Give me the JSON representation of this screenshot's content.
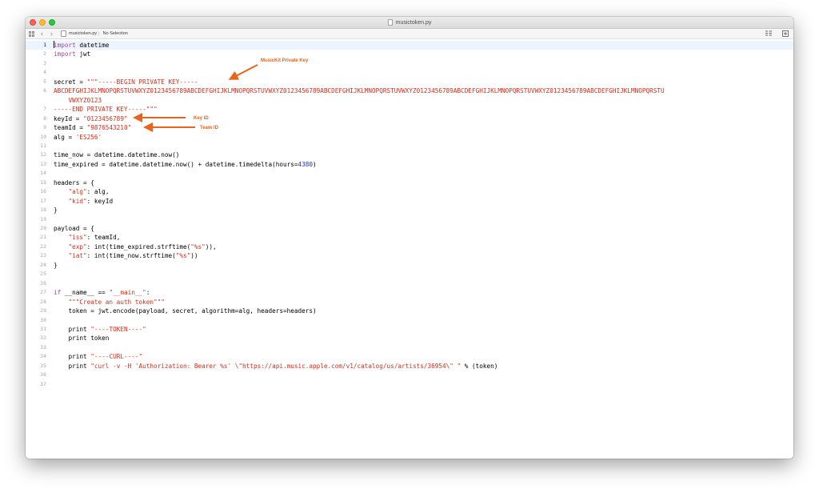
{
  "window": {
    "title": "musictoken.py"
  },
  "jumpbar": {
    "filename": "musictoken.py",
    "separator": "〉",
    "selection": "No Selection"
  },
  "annotations": {
    "private_key": "MusicKit Private Key",
    "key_id": "Key ID",
    "team_id": "Team ID",
    "color": "#e8641b"
  },
  "colors": {
    "keyword": "#ad3da4",
    "string": "#d12f1b",
    "number": "#272ad8",
    "current_line": "#ecf5ff"
  },
  "code": {
    "line_numbers": [
      "1",
      "2",
      "3",
      "4",
      "5",
      "6",
      "",
      "7",
      "8",
      "9",
      "10",
      "11",
      "12",
      "13",
      "14",
      "15",
      "16",
      "17",
      "18",
      "19",
      "20",
      "21",
      "22",
      "23",
      "24",
      "25",
      "26",
      "27",
      "28",
      "29",
      "30",
      "31",
      "32",
      "33",
      "34",
      "35",
      "36",
      "37"
    ],
    "lines": [
      [
        {
          "t": "kw",
          "v": "import"
        },
        {
          "t": "",
          "v": " datetime"
        }
      ],
      [
        {
          "t": "kw",
          "v": "import"
        },
        {
          "t": "",
          "v": " jwt"
        }
      ],
      [],
      [],
      [
        {
          "t": "",
          "v": "secret = "
        },
        {
          "t": "str",
          "v": "\"\"\"-----BEGIN PRIVATE KEY-----"
        }
      ],
      [
        {
          "t": "str",
          "v": "ABCDEFGHIJKLMNOPQRSTUVWXYZ0123456789ABCDEFGHIJKLMNOPQRSTUVWXYZ0123456789ABCDEFGHIJKLMNOPQRSTUVWXYZ0123456789ABCDEFGHIJKLMNOPQRSTUVWXYZ0123456789ABCDEFGHIJKLMNOPQRSTU"
        }
      ],
      [
        {
          "t": "str",
          "v": "    VWXYZ0123"
        }
      ],
      [
        {
          "t": "str",
          "v": "-----END PRIVATE KEY-----\"\"\""
        }
      ],
      [
        {
          "t": "",
          "v": "keyId = "
        },
        {
          "t": "str",
          "v": "\"0123456789\""
        }
      ],
      [
        {
          "t": "",
          "v": "teamId = "
        },
        {
          "t": "str",
          "v": "\"9876543210\""
        }
      ],
      [
        {
          "t": "",
          "v": "alg = "
        },
        {
          "t": "str",
          "v": "'ES256'"
        }
      ],
      [],
      [
        {
          "t": "",
          "v": "time_now = datetime.datetime.now()"
        }
      ],
      [
        {
          "t": "",
          "v": "time_expired = datetime.datetime.now() + datetime.timedelta(hours="
        },
        {
          "t": "num",
          "v": "4380"
        },
        {
          "t": "",
          "v": ")"
        }
      ],
      [],
      [
        {
          "t": "",
          "v": "headers = {"
        }
      ],
      [
        {
          "t": "",
          "v": "    "
        },
        {
          "t": "str",
          "v": "\"alg\""
        },
        {
          "t": "",
          "v": ": alg,"
        }
      ],
      [
        {
          "t": "",
          "v": "    "
        },
        {
          "t": "str",
          "v": "\"kid\""
        },
        {
          "t": "",
          "v": ": keyId"
        }
      ],
      [
        {
          "t": "",
          "v": "}"
        }
      ],
      [],
      [
        {
          "t": "",
          "v": "payload = {"
        }
      ],
      [
        {
          "t": "",
          "v": "    "
        },
        {
          "t": "str",
          "v": "\"iss\""
        },
        {
          "t": "",
          "v": ": teamId,"
        }
      ],
      [
        {
          "t": "",
          "v": "    "
        },
        {
          "t": "str",
          "v": "\"exp\""
        },
        {
          "t": "",
          "v": ": int(time_expired.strftime("
        },
        {
          "t": "str",
          "v": "\"%s\""
        },
        {
          "t": "",
          "v": ")),"
        }
      ],
      [
        {
          "t": "",
          "v": "    "
        },
        {
          "t": "str",
          "v": "\"iat\""
        },
        {
          "t": "",
          "v": ": int(time_now.strftime("
        },
        {
          "t": "str",
          "v": "\"%s\""
        },
        {
          "t": "",
          "v": "))"
        }
      ],
      [
        {
          "t": "",
          "v": "}"
        }
      ],
      [],
      [],
      [
        {
          "t": "kw",
          "v": "if"
        },
        {
          "t": "",
          "v": " __name__ == "
        },
        {
          "t": "str",
          "v": "\"__main__\""
        },
        {
          "t": "",
          "v": ":"
        }
      ],
      [
        {
          "t": "",
          "v": "    "
        },
        {
          "t": "str",
          "v": "\"\"\"Create an auth token\"\"\""
        }
      ],
      [
        {
          "t": "",
          "v": "    token = jwt.encode(payload, secret, algorithm=alg, headers=headers)"
        }
      ],
      [],
      [
        {
          "t": "",
          "v": "    print "
        },
        {
          "t": "str",
          "v": "\"----TOKEN----\""
        }
      ],
      [
        {
          "t": "",
          "v": "    print token"
        }
      ],
      [],
      [
        {
          "t": "",
          "v": "    print "
        },
        {
          "t": "str",
          "v": "\"----CURL----\""
        }
      ],
      [
        {
          "t": "",
          "v": "    print "
        },
        {
          "t": "str",
          "v": "\"curl -v -H 'Authorization: Bearer %s' \\\"https://api.music.apple.com/v1/catalog/us/artists/36954\\\" \""
        },
        {
          "t": "",
          "v": " % (token)"
        }
      ],
      [],
      []
    ]
  }
}
